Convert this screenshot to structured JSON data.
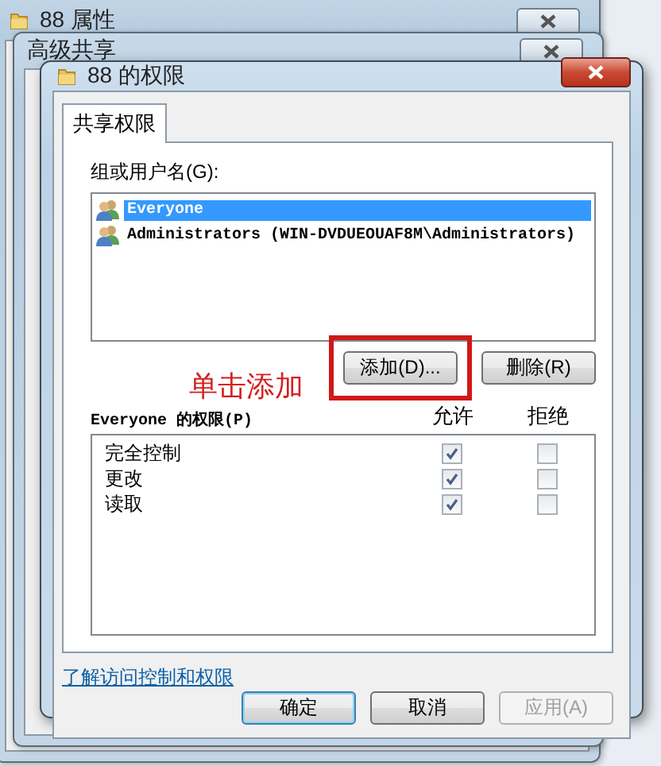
{
  "background_windows": [
    {
      "title": "88 属性"
    },
    {
      "title": "高级共享"
    }
  ],
  "dialog": {
    "title": "88 的权限",
    "tabs": [
      {
        "label": "共享权限",
        "selected": true
      }
    ],
    "group_label": "组或用户名(G):",
    "users": [
      {
        "name": "Everyone",
        "selected": true
      },
      {
        "name": "Administrators (WIN-DVDUEOUAF8M\\Administrators)",
        "selected": false
      }
    ],
    "add_button": "添加(D)...",
    "remove_button": "删除(R)",
    "annotation": "单击添加",
    "permissions_label": "Everyone 的权限(P)",
    "columns": [
      "允许",
      "拒绝"
    ],
    "permissions": [
      {
        "name": "完全控制",
        "allow": true,
        "deny": false
      },
      {
        "name": "更改",
        "allow": true,
        "deny": false
      },
      {
        "name": "读取",
        "allow": true,
        "deny": false
      }
    ],
    "link": "了解访问控制和权限",
    "buttons": [
      {
        "label": "确定",
        "default": true,
        "disabled": false
      },
      {
        "label": "取消",
        "default": false,
        "disabled": false
      },
      {
        "label": "应用(A)",
        "default": false,
        "disabled": true
      }
    ]
  }
}
